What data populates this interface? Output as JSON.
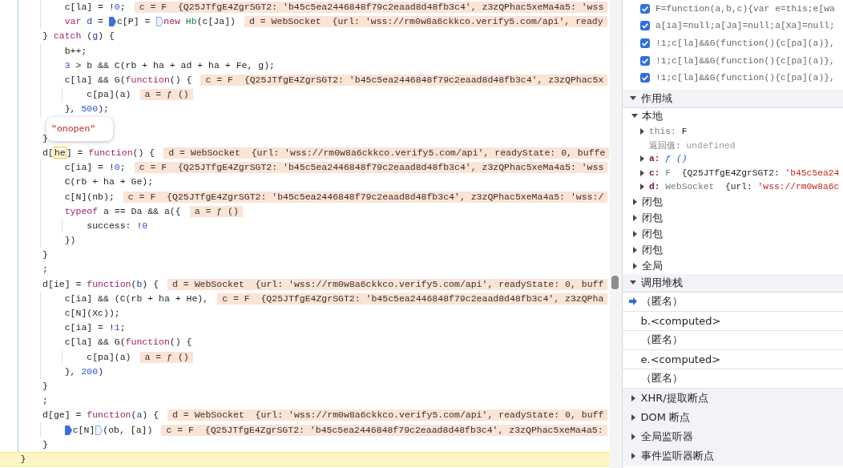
{
  "editor": {
    "lines": [
      {
        "children": [
          {
            "children": [
              {
                "paused": false,
                "segments": [
                  {
                    "kind": "code",
                    "tokens": [
                      {
                        "kind": "plain",
                        "text": "c[la] = !"
                      },
                      {
                        "kind": "number",
                        "text": "0"
                      },
                      {
                        "kind": "plain",
                        "text": ";"
                      }
                    ]
                  }
                ],
                "inline_value": "c = F  {Q25JTfgE4ZgrSGT2: 'b45c5ea2446848f79c2eaad8d48fb3c4', z3zQPhac5xeMa4a5: 'wss"
              },
              {
                "paused": false,
                "segments": [
                  {
                    "kind": "code",
                    "tokens": [
                      {
                        "kind": "keyword",
                        "text": "var "
                      },
                      {
                        "kind": "def",
                        "text": "d"
                      },
                      {
                        "kind": "plain",
                        "text": " = "
                      }
                    ]
                  },
                  {
                    "kind": "marker",
                    "active": true
                  },
                  {
                    "kind": "code",
                    "tokens": [
                      {
                        "kind": "plain",
                        "text": "c[P] = "
                      }
                    ]
                  },
                  {
                    "kind": "marker",
                    "active": false
                  },
                  {
                    "kind": "code",
                    "tokens": [
                      {
                        "kind": "keyword",
                        "text": "new "
                      },
                      {
                        "kind": "class",
                        "text": "Hb"
                      },
                      {
                        "kind": "plain",
                        "text": "(c[Ja])"
                      }
                    ]
                  }
                ],
                "inline_value": "d = WebSocket  {url: 'wss://rm0w8a6ckkco.verify5.com/api', ready"
              }
            ]
          },
          {
            "paused": false,
            "segments": [
              {
                "kind": "code",
                "tokens": [
                  {
                    "kind": "plain",
                    "text": "} "
                  },
                  {
                    "kind": "keyword",
                    "text": "catch"
                  },
                  {
                    "kind": "plain",
                    "text": " ("
                  },
                  {
                    "kind": "def",
                    "text": "g"
                  },
                  {
                    "kind": "plain",
                    "text": ") {"
                  }
                ]
              }
            ],
            "children": [
              {
                "paused": false,
                "segments": [
                  {
                    "kind": "code",
                    "tokens": [
                      {
                        "kind": "plain",
                        "text": "b++;"
                      }
                    ]
                  }
                ]
              },
              {
                "paused": false,
                "segments": [
                  {
                    "kind": "code",
                    "tokens": [
                      {
                        "kind": "number",
                        "text": "3"
                      },
                      {
                        "kind": "plain",
                        "text": " > b && C(rb + ha + ad + ha + Fe, g);"
                      }
                    ]
                  }
                ]
              },
              {
                "paused": false,
                "segments": [
                  {
                    "kind": "code",
                    "tokens": [
                      {
                        "kind": "plain",
                        "text": "c[la] && G("
                      },
                      {
                        "kind": "keyword",
                        "text": "function"
                      },
                      {
                        "kind": "plain",
                        "text": "() {"
                      }
                    ]
                  }
                ],
                "inline_value": "c = F  {Q25JTfgE4ZgrSGT2: 'b45c5ea2446848f79c2eaad8d48fb3c4', z3zQPhac5x",
                "children": [
                  {
                    "paused": false,
                    "segments": [
                      {
                        "kind": "code",
                        "tokens": [
                          {
                            "kind": "plain",
                            "text": "c[pa](a)"
                          }
                        ]
                      }
                    ],
                    "inline_value": "a = ƒ ()"
                  }
                ]
              },
              {
                "paused": false,
                "segments": [
                  {
                    "kind": "code",
                    "tokens": [
                      {
                        "kind": "plain",
                        "text": "}, "
                      },
                      {
                        "kind": "number",
                        "text": "500"
                      },
                      {
                        "kind": "plain",
                        "text": ");"
                      }
                    ]
                  }
                ]
              }
            ]
          },
          {
            "paused": false
          },
          {
            "paused": false,
            "segments": [
              {
                "kind": "code",
                "tokens": [
                  {
                    "kind": "plain",
                    "text": "}"
                  }
                ]
              }
            ]
          },
          {
            "paused": false,
            "segments": [
              {
                "kind": "code",
                "tokens": [
                  {
                    "kind": "plain",
                    "text": "d["
                  }
                ]
              },
              {
                "kind": "hover",
                "text": "he"
              },
              {
                "kind": "code",
                "tokens": [
                  {
                    "kind": "plain",
                    "text": "] = "
                  },
                  {
                    "kind": "keyword",
                    "text": "function"
                  },
                  {
                    "kind": "plain",
                    "text": "() {"
                  }
                ]
              }
            ],
            "inline_value": "d = WebSocket  {url: 'wss://rm0w8a6ckkco.verify5.com/api', readyState: 0, buffe",
            "children": [
              {
                "paused": false,
                "segments": [
                  {
                    "kind": "code",
                    "tokens": [
                      {
                        "kind": "plain",
                        "text": "c[ia] = !"
                      },
                      {
                        "kind": "number",
                        "text": "0"
                      },
                      {
                        "kind": "plain",
                        "text": ";"
                      }
                    ]
                  }
                ],
                "inline_value": "c = F  {Q25JTfgE4ZgrSGT2: 'b45c5ea2446848f79c2eaad8d48fb3c4', z3zQPhac5xeMa4a5: 'wss"
              },
              {
                "paused": false,
                "segments": [
                  {
                    "kind": "code",
                    "tokens": [
                      {
                        "kind": "plain",
                        "text": "C(rb + ha + Ge);"
                      }
                    ]
                  }
                ]
              },
              {
                "paused": false,
                "segments": [
                  {
                    "kind": "code",
                    "tokens": [
                      {
                        "kind": "plain",
                        "text": "c[N](nb);"
                      }
                    ]
                  }
                ],
                "inline_value": "c = F  {Q25JTfgE4ZgrSGT2: 'b45c5ea2446848f79c2eaad8d48fb3c4', z3zQPhac5xeMa4a5: 'wss:/"
              },
              {
                "paused": false,
                "segments": [
                  {
                    "kind": "code",
                    "tokens": [
                      {
                        "kind": "keyword",
                        "text": "typeof"
                      },
                      {
                        "kind": "plain",
                        "text": " a == Da && a({"
                      }
                    ]
                  }
                ],
                "inline_value": "a = ƒ ()",
                "children": [
                  {
                    "paused": false,
                    "segments": [
                      {
                        "kind": "code",
                        "tokens": [
                          {
                            "kind": "plain",
                            "text": "success: !"
                          },
                          {
                            "kind": "number",
                            "text": "0"
                          }
                        ]
                      }
                    ]
                  }
                ]
              },
              {
                "paused": false,
                "segments": [
                  {
                    "kind": "code",
                    "tokens": [
                      {
                        "kind": "plain",
                        "text": "})"
                      }
                    ]
                  }
                ]
              }
            ]
          },
          {
            "paused": false,
            "segments": [
              {
                "kind": "code",
                "tokens": [
                  {
                    "kind": "plain",
                    "text": "}"
                  }
                ]
              }
            ]
          },
          {
            "paused": false,
            "segments": [
              {
                "kind": "code",
                "tokens": [
                  {
                    "kind": "plain",
                    "text": ";"
                  }
                ]
              }
            ]
          },
          {
            "paused": false,
            "segments": [
              {
                "kind": "code",
                "tokens": [
                  {
                    "kind": "plain",
                    "text": "d[ie] = "
                  },
                  {
                    "kind": "keyword",
                    "text": "function"
                  },
                  {
                    "kind": "plain",
                    "text": "("
                  },
                  {
                    "kind": "def",
                    "text": "b"
                  },
                  {
                    "kind": "plain",
                    "text": ") {"
                  }
                ]
              }
            ],
            "inline_value": "d = WebSocket  {url: 'wss://rm0w8a6ckkco.verify5.com/api', readyState: 0, buff",
            "children": [
              {
                "paused": false,
                "segments": [
                  {
                    "kind": "code",
                    "tokens": [
                      {
                        "kind": "plain",
                        "text": "c[ia] && (C(rb + ha + He),"
                      }
                    ]
                  }
                ],
                "inline_value": "c = F  {Q25JTfgE4ZgrSGT2: 'b45c5ea2446848f79c2eaad8d48fb3c4', z3zQPha"
              },
              {
                "paused": false,
                "segments": [
                  {
                    "kind": "code",
                    "tokens": [
                      {
                        "kind": "plain",
                        "text": "c[N](Xc));"
                      }
                    ]
                  }
                ]
              },
              {
                "paused": false,
                "segments": [
                  {
                    "kind": "code",
                    "tokens": [
                      {
                        "kind": "plain",
                        "text": "c[ia] = !"
                      },
                      {
                        "kind": "number",
                        "text": "1"
                      },
                      {
                        "kind": "plain",
                        "text": ";"
                      }
                    ]
                  }
                ]
              },
              {
                "paused": false,
                "segments": [
                  {
                    "kind": "code",
                    "tokens": [
                      {
                        "kind": "plain",
                        "text": "c[la] && G("
                      },
                      {
                        "kind": "keyword",
                        "text": "function"
                      },
                      {
                        "kind": "plain",
                        "text": "() {"
                      }
                    ]
                  }
                ],
                "children": [
                  {
                    "paused": false,
                    "segments": [
                      {
                        "kind": "code",
                        "tokens": [
                          {
                            "kind": "plain",
                            "text": "c[pa](a)"
                          }
                        ]
                      }
                    ],
                    "inline_value": "a = ƒ ()"
                  }
                ]
              },
              {
                "paused": false,
                "segments": [
                  {
                    "kind": "code",
                    "tokens": [
                      {
                        "kind": "plain",
                        "text": "}, "
                      },
                      {
                        "kind": "number",
                        "text": "200"
                      },
                      {
                        "kind": "plain",
                        "text": ")"
                      }
                    ]
                  }
                ]
              }
            ]
          },
          {
            "paused": false,
            "segments": [
              {
                "kind": "code",
                "tokens": [
                  {
                    "kind": "plain",
                    "text": "}"
                  }
                ]
              }
            ]
          },
          {
            "paused": false,
            "segments": [
              {
                "kind": "code",
                "tokens": [
                  {
                    "kind": "plain",
                    "text": ";"
                  }
                ]
              }
            ]
          },
          {
            "paused": false,
            "segments": [
              {
                "kind": "code",
                "tokens": [
                  {
                    "kind": "plain",
                    "text": "d[ge] = "
                  },
                  {
                    "kind": "keyword",
                    "text": "function"
                  },
                  {
                    "kind": "plain",
                    "text": "("
                  },
                  {
                    "kind": "def",
                    "text": "a"
                  },
                  {
                    "kind": "plain",
                    "text": ") {"
                  }
                ]
              }
            ],
            "inline_value": "d = WebSocket  {url: 'wss://rm0w8a6ckkco.verify5.com/api', readyState: 0, buff",
            "children": [
              {
                "paused": false,
                "segments": [
                  {
                    "kind": "marker",
                    "active": true
                  },
                  {
                    "kind": "code",
                    "tokens": [
                      {
                        "kind": "plain",
                        "text": "c[N]"
                      }
                    ]
                  },
                  {
                    "kind": "marker",
                    "active": false
                  },
                  {
                    "kind": "code",
                    "tokens": [
                      {
                        "kind": "plain",
                        "text": "(ob, [a])"
                      }
                    ]
                  }
                ],
                "inline_value": "c = F  {Q25JTfgE4ZgrSGT2: 'b45c5ea2446848f79c2eaad8d48fb3c4', z3zQPhac5xeMa4a5:"
              }
            ]
          },
          {
            "paused": false,
            "segments": [
              {
                "kind": "code",
                "tokens": [
                  {
                    "kind": "plain",
                    "text": "}"
                  }
                ]
              }
            ]
          }
        ]
      },
      {
        "paused": true,
        "segments": [
          {
            "kind": "code",
            "tokens": [
              {
                "kind": "plain",
                "text": "}"
              }
            ]
          }
        ]
      }
    ],
    "hover_popup": {
      "text": "\"onopen\""
    }
  },
  "debugger": {
    "breakpoints": [
      {
        "checked": true,
        "code": "F=function(a,b,c){var e=this;e[wa"
      },
      {
        "checked": true,
        "code": "a[ia]=null;a[Ja]=null;a[Xa]=null;"
      },
      {
        "checked": true,
        "code": "!1;c[la]&&G(function(){c[pa](a)},"
      },
      {
        "checked": true,
        "code": "!1;c[la]&&G(function(){c[pa](a)},"
      },
      {
        "checked": true,
        "code": "!1;c[la]&&G(function(){c[pa](a)},"
      }
    ],
    "sections": [
      {
        "title": "作用域",
        "expanded": true,
        "scopes": [
          {
            "name": "本地",
            "expanded": true,
            "variables": [
              {
                "name": "this:",
                "kind": "synthetic",
                "expandable": true,
                "parts": [
                  {
                    "kind": "plain",
                    "text": "F"
                  }
                ]
              },
              {
                "name": "返回值:",
                "kind": "synthetic",
                "expandable": false,
                "parts": [
                  {
                    "kind": "undefined",
                    "text": "undefined"
                  }
                ]
              },
              {
                "name": "a:",
                "kind": "own",
                "expandable": true,
                "parts": [
                  {
                    "kind": "function",
                    "text": "ƒ ()"
                  }
                ]
              },
              {
                "name": "c:",
                "kind": "own",
                "expandable": true,
                "parts": [
                  {
                    "kind": "type",
                    "text": "F"
                  },
                  {
                    "kind": "plain",
                    "text": "  {Q25JTfgE4ZgrSGT2: "
                  },
                  {
                    "kind": "string",
                    "text": "'b45c5ea24"
                  }
                ]
              },
              {
                "name": "d:",
                "kind": "own",
                "expandable": true,
                "parts": [
                  {
                    "kind": "type",
                    "text": "WebSocket"
                  },
                  {
                    "kind": "plain",
                    "text": "  {url: "
                  },
                  {
                    "kind": "string",
                    "text": "'wss://rm0w8a6c"
                  }
                ]
              }
            ]
          },
          {
            "name": "闭包",
            "expanded": false
          },
          {
            "name": "闭包",
            "expanded": false
          },
          {
            "name": "闭包",
            "expanded": false
          },
          {
            "name": "闭包",
            "expanded": false
          },
          {
            "name": "全局",
            "expanded": false
          }
        ]
      },
      {
        "title": "调用堆栈",
        "expanded": true,
        "frames": [
          {
            "name": "（匿名）",
            "current": true
          },
          {
            "name": "b.<computed>",
            "current": false
          },
          {
            "name": "（匿名）",
            "current": false
          },
          {
            "name": "e.<computed>",
            "current": false
          },
          {
            "name": "（匿名）",
            "current": false
          }
        ]
      },
      {
        "title": "XHR/提取断点",
        "expanded": false
      },
      {
        "title": "DOM 断点",
        "expanded": false
      },
      {
        "title": "全局监听器",
        "expanded": false
      },
      {
        "title": "事件监听器断点",
        "expanded": false
      }
    ]
  }
}
